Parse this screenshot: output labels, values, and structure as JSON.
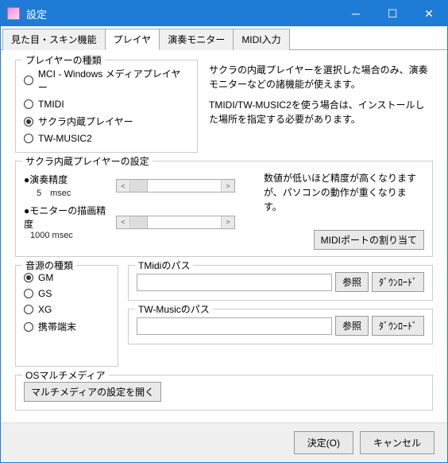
{
  "window": {
    "title": "設定"
  },
  "tabs": {
    "t0": "見た目・スキン機能",
    "t1": "プレイヤ",
    "t2": "演奏モニター",
    "t3": "MIDI入力"
  },
  "playerType": {
    "legend": "プレイヤーの種類",
    "opt0": "MCI - Windows メディアプレイヤー",
    "opt1": "TMIDI",
    "opt2": "サクラ内蔵プレイヤー",
    "opt3": "TW-MUSIC2"
  },
  "playerInfo": {
    "line1": "サクラの内蔵プレイヤーを選択した場合のみ、演奏モニターなどの諸機能が使えます。",
    "line2": "TMIDI/TW-MUSIC2を使う場合は、インストールした場所を指定する必要があります。"
  },
  "playback": {
    "legend": "サクラ内蔵プレイヤーの設定",
    "precLabel": "●演奏精度",
    "precVal": "5　msec",
    "monLabel": "●モニターの描画精度",
    "monVal": "1000  msec",
    "note": "数値が低いほど精度が高くなりますが、パソコンの動作が重くなります。",
    "midiPortBtn": "MIDIポートの割り当て"
  },
  "source": {
    "legend": "音源の種類",
    "opt0": "GM",
    "opt1": "GS",
    "opt2": "XG",
    "opt3": "携帯端末"
  },
  "paths": {
    "tmidiLegend": "TMidiのパス",
    "twLegend": "TW-Musicのパス",
    "browse": "参照",
    "download": "ﾀﾞｳﾝﾛｰﾄﾞ",
    "tmidiVal": "",
    "twVal": ""
  },
  "osmm": {
    "legend": "OSマルチメディア",
    "btn": "マルチメディアの設定を開く"
  },
  "footer": {
    "ok": "決定(O)",
    "cancel": "キャンセル"
  }
}
